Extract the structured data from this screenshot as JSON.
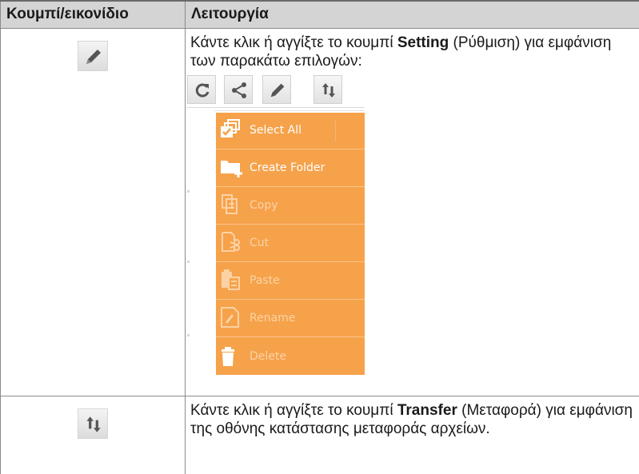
{
  "table": {
    "header": {
      "col1": "Κουμπί/εικονίδιο",
      "col2": "Λειτουργία"
    },
    "rows": [
      {
        "icon": "pencil-icon",
        "desc_pre": "Κάντε κλικ ή αγγίξτε το κουμπί ",
        "desc_bold": "Setting",
        "desc_post": " (Ρύθμιση) για εμφάνιση των παρακάτω επιλογών:",
        "toolbar": [
          "refresh-icon",
          "share-icon",
          "pencil-icon",
          "transfer-icon"
        ],
        "menu": [
          {
            "label": "Select All",
            "icon": "select-all-icon",
            "enabled": true
          },
          {
            "label": "Create Folder",
            "icon": "create-folder-icon",
            "enabled": true
          },
          {
            "label": "Copy",
            "icon": "copy-icon",
            "enabled": false
          },
          {
            "label": "Cut",
            "icon": "cut-icon",
            "enabled": false
          },
          {
            "label": "Paste",
            "icon": "paste-icon",
            "enabled": false
          },
          {
            "label": "Rename",
            "icon": "rename-icon",
            "enabled": false
          },
          {
            "label": "Delete",
            "icon": "delete-icon",
            "enabled": false
          }
        ]
      },
      {
        "icon": "transfer-icon",
        "desc_pre": "Κάντε κλικ ή αγγίξτε το κουμπί ",
        "desc_bold": "Transfer",
        "desc_post": " (Μεταφορά) για εμφάνιση της οθόνης κατάστασης μεταφοράς αρχείων."
      }
    ]
  },
  "colors": {
    "menu_bg": "#f6a24b",
    "header_bg": "#d4d4d4"
  }
}
